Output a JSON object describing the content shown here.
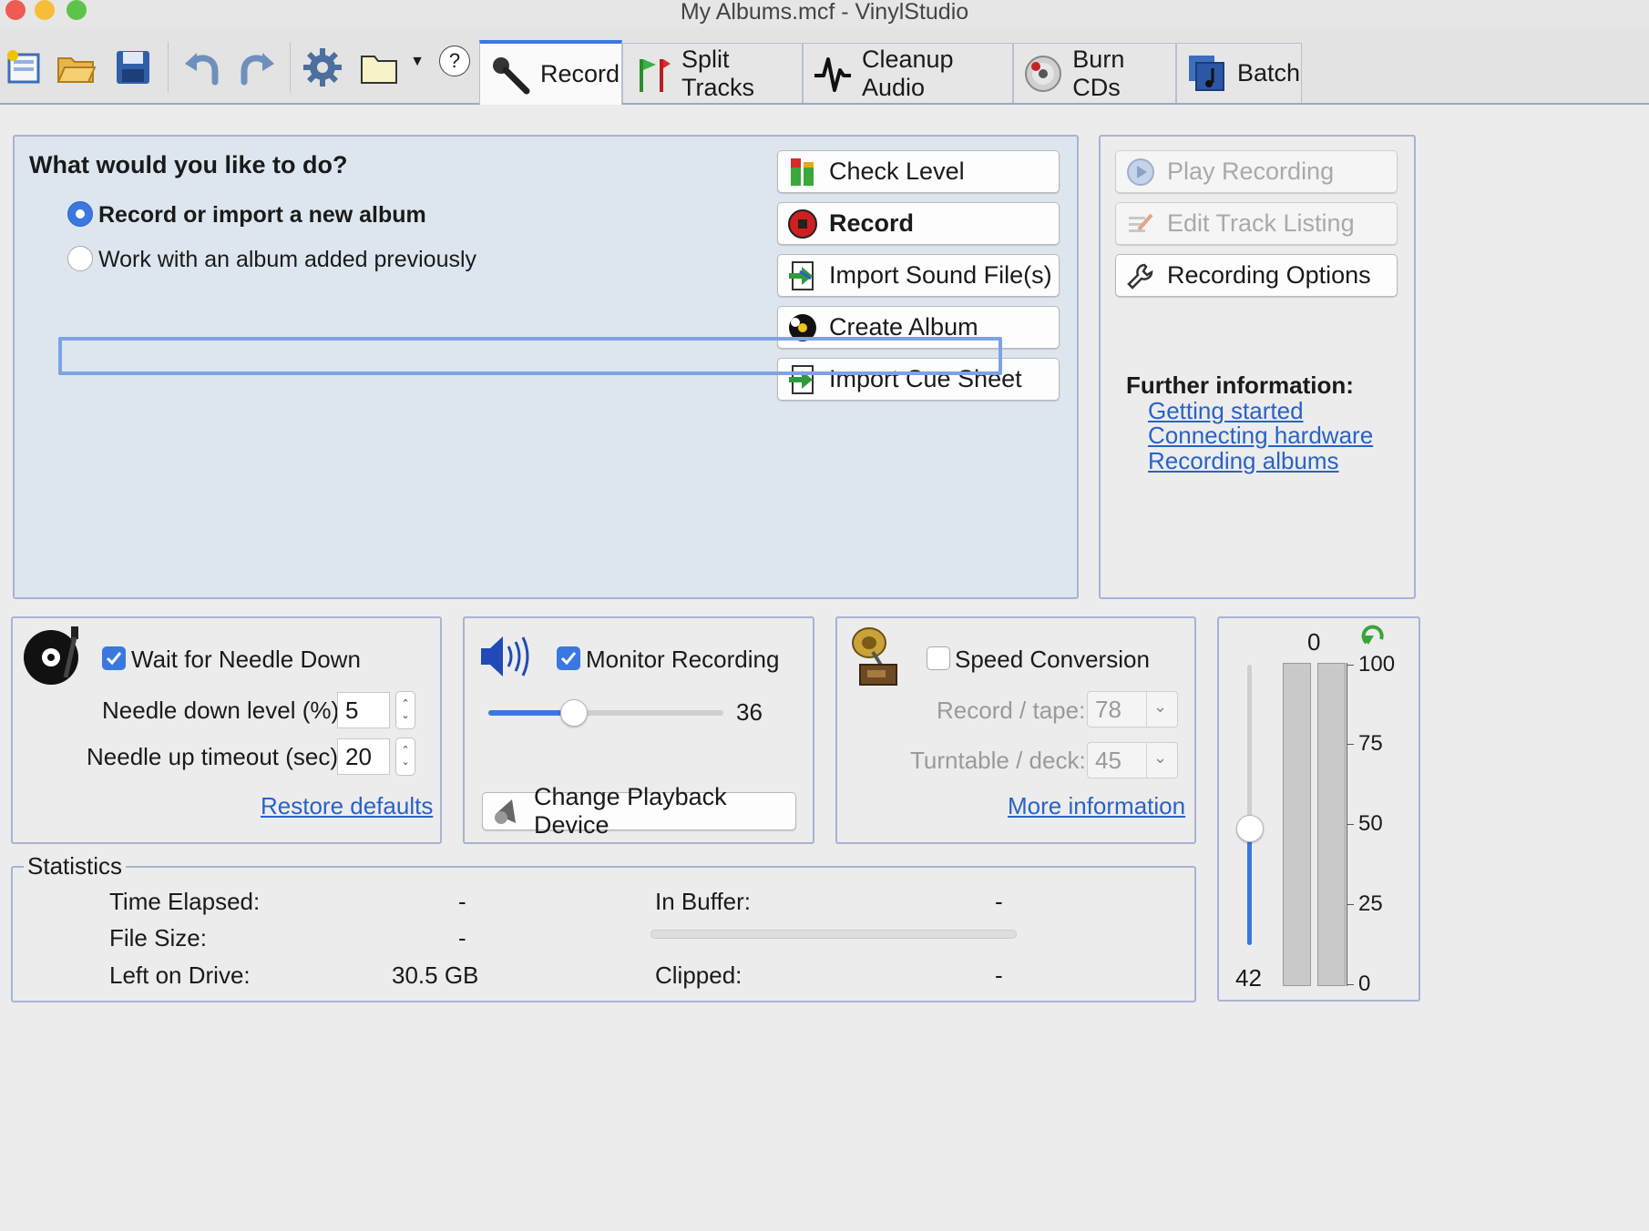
{
  "window": {
    "title": "My Albums.mcf - VinylStudio"
  },
  "tabs": [
    {
      "label": "Record"
    },
    {
      "label": "Split Tracks"
    },
    {
      "label": "Cleanup Audio"
    },
    {
      "label": "Burn CDs"
    },
    {
      "label": "Batch"
    }
  ],
  "toolbar": {
    "help_label": "?"
  },
  "main": {
    "question": "What would you like to do?",
    "options": [
      {
        "label": "Record or import a new album",
        "selected": true
      },
      {
        "label": "Work with an album added previously",
        "selected": false
      }
    ],
    "actions": {
      "check_level": "Check Level",
      "record": "Record",
      "import_sound": "Import Sound File(s)",
      "create_album": "Create Album",
      "import_cue": "Import Cue Sheet"
    }
  },
  "side": {
    "play_recording": "Play Recording",
    "edit_track_listing": "Edit Track Listing",
    "recording_options": "Recording Options",
    "further_info_title": "Further information:",
    "links": [
      "Getting started",
      "Connecting hardware",
      "Recording albums"
    ]
  },
  "needle": {
    "checkbox_label": "Wait for Needle Down",
    "checked": true,
    "down_level_label": "Needle down level (%):",
    "down_level_value": "5",
    "up_timeout_label": "Needle up timeout (sec):",
    "up_timeout_value": "20",
    "restore_defaults": "Restore defaults"
  },
  "monitor": {
    "checkbox_label": "Monitor Recording",
    "checked": true,
    "volume_value": "36",
    "volume_fraction": 0.36,
    "change_device": "Change Playback Device"
  },
  "speed": {
    "checkbox_label": "Speed Conversion",
    "checked": false,
    "record_tape_label": "Record / tape:",
    "record_tape_value": "78",
    "turntable_label": "Turntable / deck:",
    "turntable_value": "45",
    "more_info": "More information"
  },
  "statistics": {
    "title": "Statistics",
    "time_elapsed_label": "Time Elapsed:",
    "time_elapsed_value": "-",
    "file_size_label": "File Size:",
    "file_size_value": "-",
    "left_on_drive_label": "Left on Drive:",
    "left_on_drive_value": "30.5 GB",
    "in_buffer_label": "In Buffer:",
    "in_buffer_value": "-",
    "clipped_label": "Clipped:",
    "clipped_value": "-"
  },
  "meter": {
    "peak_value": "0",
    "gain_value": "42",
    "gain_fraction": 0.42,
    "scale": [
      "100",
      "75",
      "50",
      "25",
      "0"
    ]
  },
  "colors": {
    "accent": "#3a78e0",
    "panel_bg": "#dde6ee",
    "panel_border": "#a7b3d6",
    "link": "#2962c7"
  }
}
